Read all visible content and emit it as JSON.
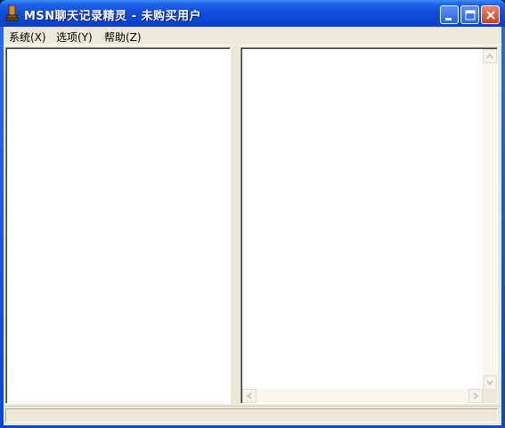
{
  "window": {
    "title": "MSN聊天记录精灵 - 未购买用户",
    "icon": "app-icon",
    "controls": [
      "minimize-icon",
      "maximize-icon",
      "close-icon"
    ]
  },
  "menu": {
    "items": [
      {
        "label": "系统(X)"
      },
      {
        "label": "选项(Y)"
      },
      {
        "label": "帮助(Z)"
      }
    ]
  },
  "left_pane": {
    "content": ""
  },
  "right_pane": {
    "content": ""
  },
  "status": {
    "text": ""
  },
  "colors": {
    "titlebar": "#0b4ad9",
    "close_button": "#c8421d",
    "face": "#ece9d8"
  }
}
